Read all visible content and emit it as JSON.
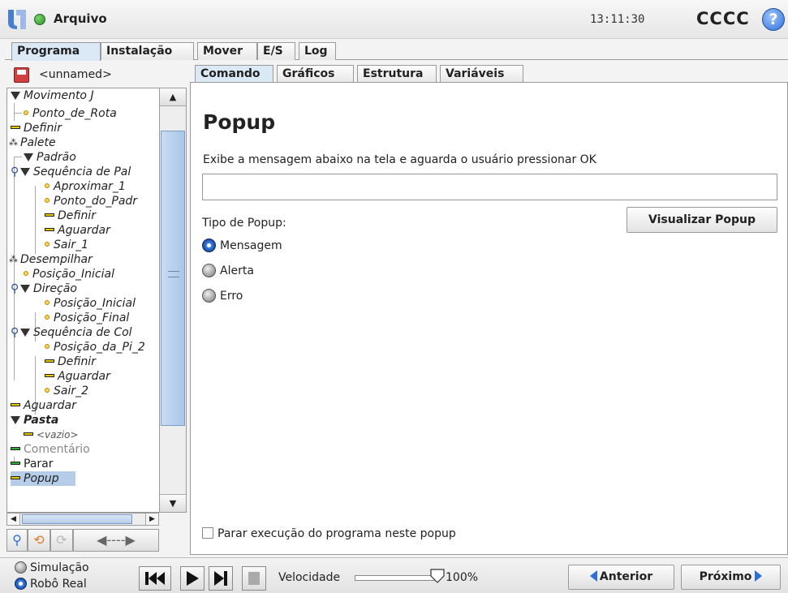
{
  "titlebar": {
    "app_menu": "Arquivo",
    "clock": "13:11:30",
    "robot_name": "CCCC",
    "help": "?"
  },
  "main_tabs": [
    "Programa",
    "Instalação",
    "Mover",
    "E/S",
    "Log"
  ],
  "program": {
    "name": "<unnamed>"
  },
  "tree": {
    "nodes": [
      {
        "label": "Movimento J"
      },
      {
        "label": "Ponto_de_Rota"
      },
      {
        "label": "Definir"
      },
      {
        "label": "Palete"
      },
      {
        "label": "Padrão"
      },
      {
        "label": "Sequência de Pal"
      },
      {
        "label": "Aproximar_1"
      },
      {
        "label": "Ponto_do_Padr"
      },
      {
        "label": "Definir"
      },
      {
        "label": "Aguardar"
      },
      {
        "label": "Sair_1"
      },
      {
        "label": "Desempilhar"
      },
      {
        "label": "Posição_Inicial"
      },
      {
        "label": "Direção"
      },
      {
        "label": "Posição_Inicial"
      },
      {
        "label": "Posição_Final"
      },
      {
        "label": "Sequência de Col"
      },
      {
        "label": "Posição_da_Pi_2"
      },
      {
        "label": "Definir"
      },
      {
        "label": "Aguardar"
      },
      {
        "label": "Sair_2"
      },
      {
        "label": "Aguardar"
      },
      {
        "label": "Pasta"
      },
      {
        "label": "<vazio>"
      },
      {
        "label": "Comentário"
      },
      {
        "label": "Parar"
      },
      {
        "label": "Popup"
      }
    ]
  },
  "sub_tabs": [
    "Comando",
    "Gráficos",
    "Estrutura",
    "Variáveis"
  ],
  "command": {
    "title": "Popup",
    "description": "Exibe a mensagem abaixo na tela e aguarda o usuário pressionar OK",
    "message_value": "",
    "preview_button": "Visualizar Popup",
    "type_label": "Tipo de Popup:",
    "types": [
      {
        "label": "Mensagem",
        "selected": true
      },
      {
        "label": "Alerta",
        "selected": false
      },
      {
        "label": "Erro",
        "selected": false
      }
    ],
    "stop_checkbox": "Parar execução do programa neste popup"
  },
  "bottom": {
    "modes": [
      {
        "label": "Simulação",
        "selected": false
      },
      {
        "label": "Robô Real",
        "selected": true
      }
    ],
    "speed_label": "Velocidade",
    "speed_value": "100%",
    "speed_fraction": 1.0,
    "prev_button": "Anterior",
    "next_button": "Próximo"
  },
  "colors": {
    "accent": "#2e6fd6",
    "selection": "#b5cde8",
    "status_ok": "#3a9a30"
  }
}
